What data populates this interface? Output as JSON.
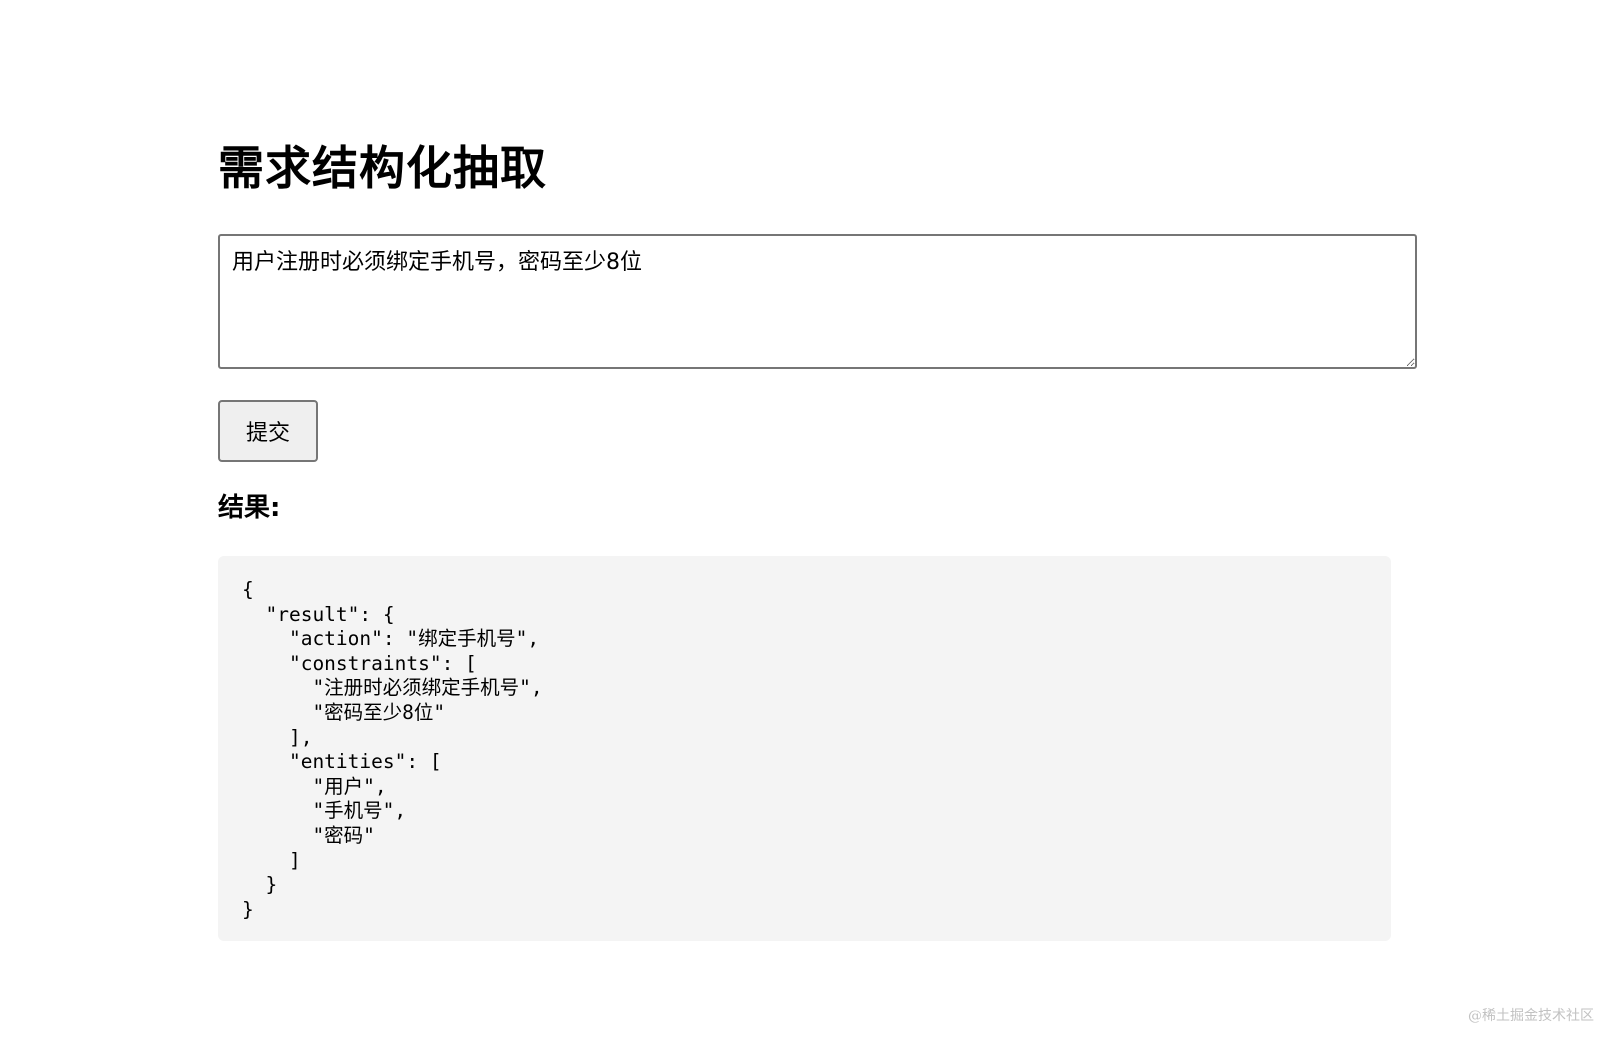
{
  "page": {
    "title": "需求结构化抽取"
  },
  "input": {
    "value": "用户注册时必须绑定手机号，密码至少8位"
  },
  "submit": {
    "label": "提交"
  },
  "result": {
    "heading": "结果:",
    "json_text": "{\n  \"result\": {\n    \"action\": \"绑定手机号\",\n    \"constraints\": [\n      \"注册时必须绑定手机号\",\n      \"密码至少8位\"\n    ],\n    \"entities\": [\n      \"用户\",\n      \"手机号\",\n      \"密码\"\n    ]\n  }\n}"
  },
  "watermark": {
    "text": "@稀土掘金技术社区"
  }
}
